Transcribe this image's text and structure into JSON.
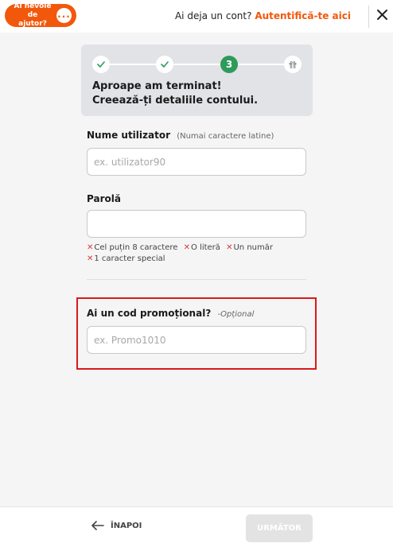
{
  "header": {
    "help_label": "Ai nevoie de ajutor?",
    "help_icon": "chat-bubble-icon",
    "login_prompt": "Ai deja un cont?",
    "login_link": "Autentifică-te aici",
    "close_icon": "close-icon"
  },
  "progress": {
    "steps": [
      {
        "state": "done",
        "icon": "check-icon"
      },
      {
        "state": "done",
        "icon": "check-icon"
      },
      {
        "state": "current",
        "label": "3"
      },
      {
        "state": "upcoming",
        "icon": "gift-icon"
      }
    ],
    "title_line1": "Aproape am terminat!",
    "title_line2": "Creează-ți detaliile contului."
  },
  "form": {
    "username": {
      "label": "Nume utilizator",
      "hint": "(Numai caractere latine)",
      "placeholder": "ex. utilizator90",
      "value": ""
    },
    "password": {
      "label": "Parolă",
      "value": "",
      "rules": [
        "Cel puțin 8 caractere",
        "O literă",
        "Un număr",
        "1 caracter special"
      ]
    },
    "promo": {
      "label": "Ai un cod promoțional?",
      "optional": "-Opțional",
      "placeholder": "ex. Promo1010",
      "value": ""
    }
  },
  "footer": {
    "back_label": "ÎNAPOI",
    "next_label": "URMĂTOR"
  },
  "colors": {
    "accent": "#f2580c",
    "success": "#2e9b5b",
    "error": "#d83b3b",
    "highlight_border": "#d91a1a"
  }
}
